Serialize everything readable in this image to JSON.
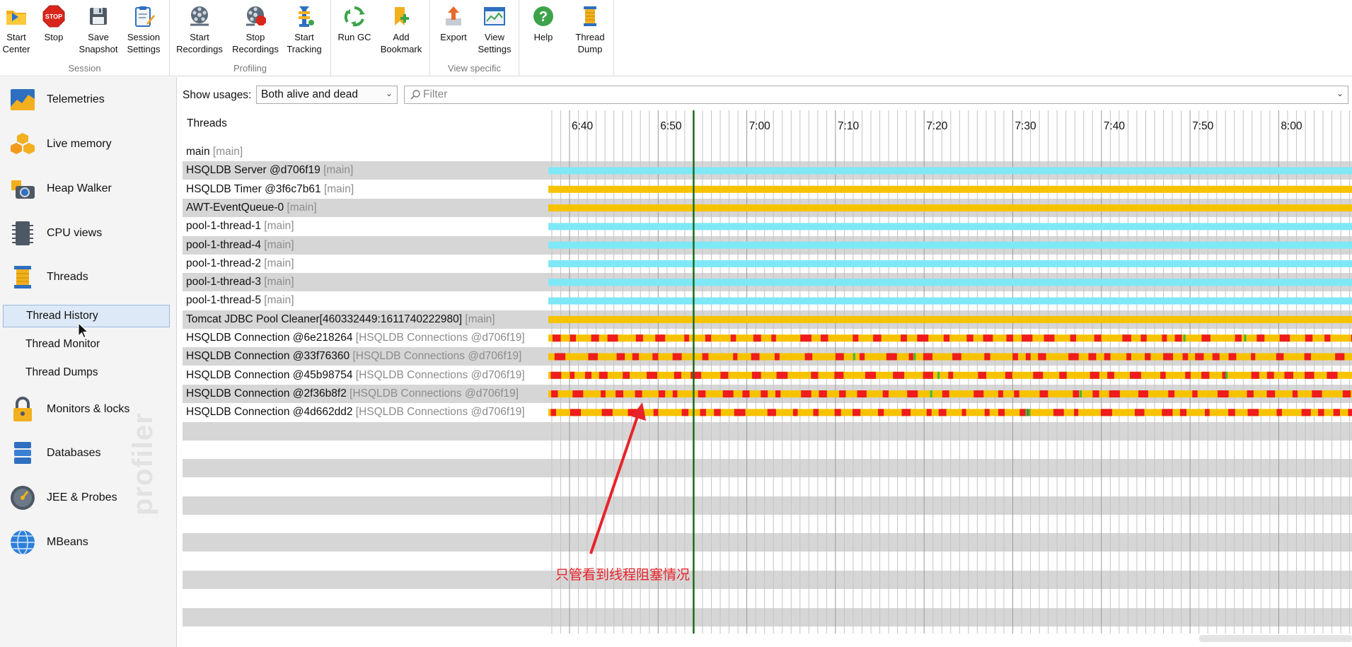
{
  "toolbar": {
    "groups": [
      {
        "label": "Session"
      },
      {
        "label": "Profiling"
      },
      {
        "label": ""
      },
      {
        "label": "View specific"
      },
      {
        "label": ""
      }
    ],
    "buttons": [
      {
        "id": "start-center",
        "label": "Start\nCenter",
        "icon": "folder-start-icon"
      },
      {
        "id": "stop",
        "label": "Stop",
        "icon": "stop-sign-icon"
      },
      {
        "id": "save-snapshot",
        "label": "Save\nSnapshot",
        "icon": "floppy-disk-icon"
      },
      {
        "id": "session-settings",
        "label": "Session\nSettings",
        "icon": "clipboard-edit-icon"
      },
      {
        "id": "start-recordings",
        "label": "Start\nRecordings",
        "icon": "film-reel-icon"
      },
      {
        "id": "stop-recordings",
        "label": "Stop\nRecordings",
        "icon": "film-reel-stop-icon"
      },
      {
        "id": "start-tracking",
        "label": "Start\nTracking",
        "icon": "tracking-icon"
      },
      {
        "id": "run-gc",
        "label": "Run GC",
        "icon": "recycle-icon"
      },
      {
        "id": "add-bookmark",
        "label": "Add\nBookmark",
        "icon": "bookmark-add-icon"
      },
      {
        "id": "export",
        "label": "Export",
        "icon": "export-arrow-icon"
      },
      {
        "id": "view-settings",
        "label": "View\nSettings",
        "icon": "view-settings-icon"
      },
      {
        "id": "help",
        "label": "Help",
        "icon": "help-question-icon"
      },
      {
        "id": "thread-dump",
        "label": "Thread\nDump",
        "icon": "thread-spool-icon"
      }
    ]
  },
  "sidebar": {
    "items": [
      {
        "label": "Telemetries",
        "icon": "telemetry-chart-icon"
      },
      {
        "label": "Live memory",
        "icon": "memory-blocks-icon"
      },
      {
        "label": "Heap Walker",
        "icon": "camera-icon"
      },
      {
        "label": "CPU views",
        "icon": "cpu-chip-icon"
      },
      {
        "label": "Threads",
        "icon": "thread-spool-icon"
      },
      {
        "label": "Monitors & locks",
        "icon": "padlock-icon"
      },
      {
        "label": "Databases",
        "icon": "database-icon"
      },
      {
        "label": "JEE & Probes",
        "icon": "gauge-icon"
      },
      {
        "label": "MBeans",
        "icon": "globe-icon"
      }
    ],
    "sub_items": [
      {
        "label": "Thread History",
        "selected": true
      },
      {
        "label": "Thread Monitor",
        "selected": false
      },
      {
        "label": "Thread Dumps",
        "selected": false
      }
    ],
    "watermark": "profiler"
  },
  "filter": {
    "usage_label": "Show usages:",
    "usage_value": "Both alive and dead",
    "filter_placeholder": "Filter"
  },
  "threads": {
    "header": "Threads",
    "time_ticks": [
      "6:40",
      "6:50",
      "7:00",
      "7:10",
      "7:20",
      "7:30",
      "7:40",
      "7:50",
      "8:00"
    ],
    "current_time": "6:54",
    "colors": {
      "runnable": "#7fe8f7",
      "waiting": "#f7c300",
      "blocked": "#ee1c1c",
      "net_io": "#3cb83c",
      "current_line": "#1a6b1a"
    },
    "rows": [
      {
        "name": "main",
        "group": "[main]",
        "state": "none"
      },
      {
        "name": "HSQLDB Server @d706f19",
        "group": "[main]",
        "state": "runnable"
      },
      {
        "name": "HSQLDB Timer @3f6c7b61",
        "group": "[main]",
        "state": "waiting"
      },
      {
        "name": "AWT-EventQueue-0",
        "group": "[main]",
        "state": "waiting"
      },
      {
        "name": "pool-1-thread-1",
        "group": "[main]",
        "state": "runnable"
      },
      {
        "name": "pool-1-thread-4",
        "group": "[main]",
        "state": "runnable"
      },
      {
        "name": "pool-1-thread-2",
        "group": "[main]",
        "state": "runnable"
      },
      {
        "name": "pool-1-thread-3",
        "group": "[main]",
        "state": "runnable"
      },
      {
        "name": "pool-1-thread-5",
        "group": "[main]",
        "state": "runnable"
      },
      {
        "name": "Tomcat JDBC Pool Cleaner[460332449:1611740222980]",
        "group": "[main]",
        "state": "waiting"
      },
      {
        "name": "HSQLDB Connection @6e218264",
        "group": "[HSQLDB Connections @d706f19]",
        "state": "mixed"
      },
      {
        "name": "HSQLDB Connection @33f76360",
        "group": "[HSQLDB Connections @d706f19]",
        "state": "mixed"
      },
      {
        "name": "HSQLDB Connection @45b98754",
        "group": "[HSQLDB Connections @d706f19]",
        "state": "mixed"
      },
      {
        "name": "HSQLDB Connection @2f36b8f2",
        "group": "[HSQLDB Connections @d706f19]",
        "state": "mixed"
      },
      {
        "name": "HSQLDB Connection @4d662dd2",
        "group": "[HSQLDB Connections @d706f19]",
        "state": "mixed"
      }
    ]
  },
  "annotation": {
    "text": "只管看到线程阻塞情况",
    "color": "#e8232a"
  }
}
